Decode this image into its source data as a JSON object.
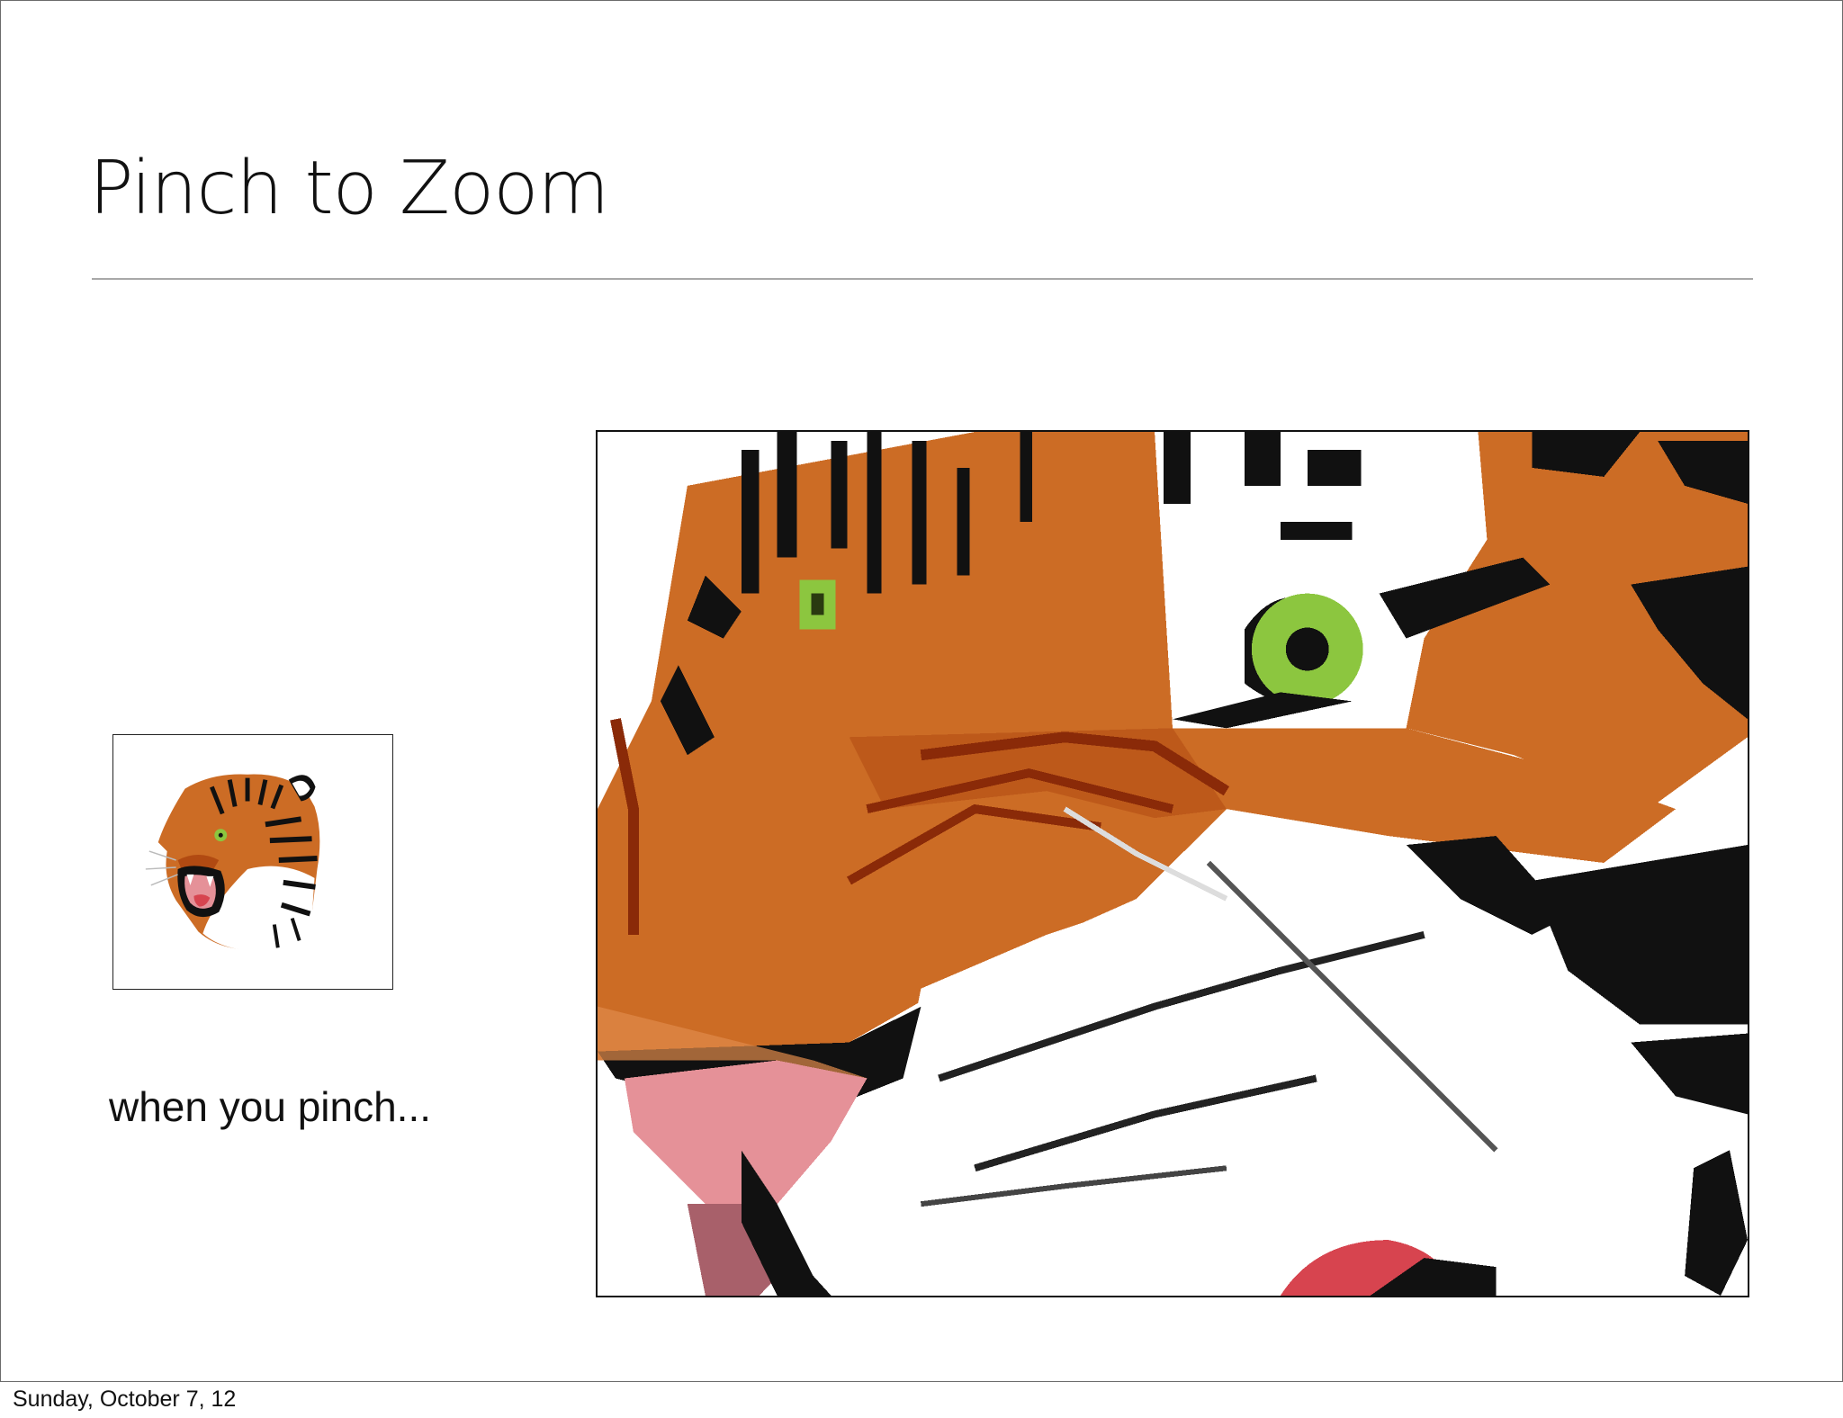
{
  "slide": {
    "title": "Pinch to Zoom",
    "caption": "when you pinch...",
    "footer_date": "Sunday, October 7, 12"
  },
  "images": {
    "thumbnail": {
      "subject": "tiger-head",
      "state": "original-size"
    },
    "zoomed": {
      "subject": "tiger-head",
      "state": "pixelated-zoom"
    }
  },
  "colors": {
    "tiger_orange": "#cc6c25",
    "tiger_dark_orange": "#b14a12",
    "stripe_black": "#111111",
    "eye_green": "#8cc63f",
    "mouth_pink": "#e59198",
    "tongue_red": "#d7444f",
    "rule_gray": "#a8a8a8"
  }
}
